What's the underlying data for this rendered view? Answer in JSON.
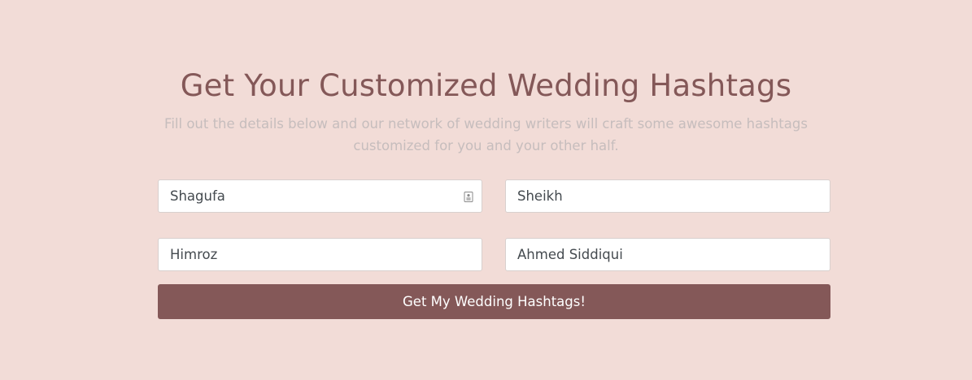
{
  "header": {
    "title": "Get Your Customized Wedding Hashtags",
    "subtitle": "Fill out the details below and our network of wedding writers will craft some awesome hashtags customized for you and your other half."
  },
  "form": {
    "field_1_value": "Shagufa",
    "field_2_value": "Sheikh",
    "field_3_value": "Himroz",
    "field_4_value": "Ahmed Siddiqui",
    "submit_label": "Get My Wedding Hashtags!"
  },
  "icons": {
    "field_1_autofill": "contact-card-icon"
  },
  "colors": {
    "background": "#f2dcd7",
    "accent": "#845858",
    "subtitle": "#c6bdbd"
  }
}
